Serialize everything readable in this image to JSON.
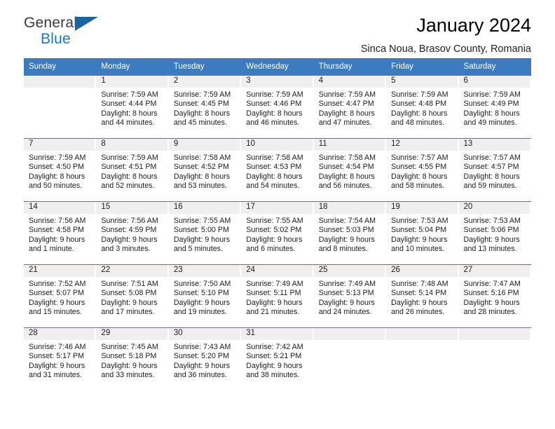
{
  "brand": {
    "name_top": "General",
    "name_bottom": "Blue",
    "accent": "#1a75c7",
    "triangle_color": "#18659f"
  },
  "header": {
    "title": "January 2024",
    "subtitle": "Sinca Noua, Brasov County, Romania"
  },
  "theme": {
    "header_row_bg": "#3a7cbf",
    "header_row_text": "#ffffff",
    "daynum_band_bg": "#efefef",
    "grid_line": "#3a7cbf"
  },
  "weekdays": [
    "Sunday",
    "Monday",
    "Tuesday",
    "Wednesday",
    "Thursday",
    "Friday",
    "Saturday"
  ],
  "labels": {
    "sunrise_prefix": "Sunrise:",
    "sunset_prefix": "Sunset:",
    "daylight_prefix": "Daylight:"
  },
  "weeks": [
    [
      {
        "day": "",
        "empty": true,
        "l1": "",
        "l2": "",
        "l3": "",
        "l4": ""
      },
      {
        "day": "1",
        "l1": "Sunrise: 7:59 AM",
        "l2": "Sunset: 4:44 PM",
        "l3": "Daylight: 8 hours",
        "l4": "and 44 minutes."
      },
      {
        "day": "2",
        "l1": "Sunrise: 7:59 AM",
        "l2": "Sunset: 4:45 PM",
        "l3": "Daylight: 8 hours",
        "l4": "and 45 minutes."
      },
      {
        "day": "3",
        "l1": "Sunrise: 7:59 AM",
        "l2": "Sunset: 4:46 PM",
        "l3": "Daylight: 8 hours",
        "l4": "and 46 minutes."
      },
      {
        "day": "4",
        "l1": "Sunrise: 7:59 AM",
        "l2": "Sunset: 4:47 PM",
        "l3": "Daylight: 8 hours",
        "l4": "and 47 minutes."
      },
      {
        "day": "5",
        "l1": "Sunrise: 7:59 AM",
        "l2": "Sunset: 4:48 PM",
        "l3": "Daylight: 8 hours",
        "l4": "and 48 minutes."
      },
      {
        "day": "6",
        "l1": "Sunrise: 7:59 AM",
        "l2": "Sunset: 4:49 PM",
        "l3": "Daylight: 8 hours",
        "l4": "and 49 minutes."
      }
    ],
    [
      {
        "day": "7",
        "l1": "Sunrise: 7:59 AM",
        "l2": "Sunset: 4:50 PM",
        "l3": "Daylight: 8 hours",
        "l4": "and 50 minutes."
      },
      {
        "day": "8",
        "l1": "Sunrise: 7:59 AM",
        "l2": "Sunset: 4:51 PM",
        "l3": "Daylight: 8 hours",
        "l4": "and 52 minutes."
      },
      {
        "day": "9",
        "l1": "Sunrise: 7:58 AM",
        "l2": "Sunset: 4:52 PM",
        "l3": "Daylight: 8 hours",
        "l4": "and 53 minutes."
      },
      {
        "day": "10",
        "l1": "Sunrise: 7:58 AM",
        "l2": "Sunset: 4:53 PM",
        "l3": "Daylight: 8 hours",
        "l4": "and 54 minutes."
      },
      {
        "day": "11",
        "l1": "Sunrise: 7:58 AM",
        "l2": "Sunset: 4:54 PM",
        "l3": "Daylight: 8 hours",
        "l4": "and 56 minutes."
      },
      {
        "day": "12",
        "l1": "Sunrise: 7:57 AM",
        "l2": "Sunset: 4:55 PM",
        "l3": "Daylight: 8 hours",
        "l4": "and 58 minutes."
      },
      {
        "day": "13",
        "l1": "Sunrise: 7:57 AM",
        "l2": "Sunset: 4:57 PM",
        "l3": "Daylight: 8 hours",
        "l4": "and 59 minutes."
      }
    ],
    [
      {
        "day": "14",
        "l1": "Sunrise: 7:56 AM",
        "l2": "Sunset: 4:58 PM",
        "l3": "Daylight: 9 hours",
        "l4": "and 1 minute."
      },
      {
        "day": "15",
        "l1": "Sunrise: 7:56 AM",
        "l2": "Sunset: 4:59 PM",
        "l3": "Daylight: 9 hours",
        "l4": "and 3 minutes."
      },
      {
        "day": "16",
        "l1": "Sunrise: 7:55 AM",
        "l2": "Sunset: 5:00 PM",
        "l3": "Daylight: 9 hours",
        "l4": "and 5 minutes."
      },
      {
        "day": "17",
        "l1": "Sunrise: 7:55 AM",
        "l2": "Sunset: 5:02 PM",
        "l3": "Daylight: 9 hours",
        "l4": "and 6 minutes."
      },
      {
        "day": "18",
        "l1": "Sunrise: 7:54 AM",
        "l2": "Sunset: 5:03 PM",
        "l3": "Daylight: 9 hours",
        "l4": "and 8 minutes."
      },
      {
        "day": "19",
        "l1": "Sunrise: 7:53 AM",
        "l2": "Sunset: 5:04 PM",
        "l3": "Daylight: 9 hours",
        "l4": "and 10 minutes."
      },
      {
        "day": "20",
        "l1": "Sunrise: 7:53 AM",
        "l2": "Sunset: 5:06 PM",
        "l3": "Daylight: 9 hours",
        "l4": "and 13 minutes."
      }
    ],
    [
      {
        "day": "21",
        "l1": "Sunrise: 7:52 AM",
        "l2": "Sunset: 5:07 PM",
        "l3": "Daylight: 9 hours",
        "l4": "and 15 minutes."
      },
      {
        "day": "22",
        "l1": "Sunrise: 7:51 AM",
        "l2": "Sunset: 5:08 PM",
        "l3": "Daylight: 9 hours",
        "l4": "and 17 minutes."
      },
      {
        "day": "23",
        "l1": "Sunrise: 7:50 AM",
        "l2": "Sunset: 5:10 PM",
        "l3": "Daylight: 9 hours",
        "l4": "and 19 minutes."
      },
      {
        "day": "24",
        "l1": "Sunrise: 7:49 AM",
        "l2": "Sunset: 5:11 PM",
        "l3": "Daylight: 9 hours",
        "l4": "and 21 minutes."
      },
      {
        "day": "25",
        "l1": "Sunrise: 7:49 AM",
        "l2": "Sunset: 5:13 PM",
        "l3": "Daylight: 9 hours",
        "l4": "and 24 minutes."
      },
      {
        "day": "26",
        "l1": "Sunrise: 7:48 AM",
        "l2": "Sunset: 5:14 PM",
        "l3": "Daylight: 9 hours",
        "l4": "and 26 minutes."
      },
      {
        "day": "27",
        "l1": "Sunrise: 7:47 AM",
        "l2": "Sunset: 5:16 PM",
        "l3": "Daylight: 9 hours",
        "l4": "and 28 minutes."
      }
    ],
    [
      {
        "day": "28",
        "l1": "Sunrise: 7:46 AM",
        "l2": "Sunset: 5:17 PM",
        "l3": "Daylight: 9 hours",
        "l4": "and 31 minutes."
      },
      {
        "day": "29",
        "l1": "Sunrise: 7:45 AM",
        "l2": "Sunset: 5:18 PM",
        "l3": "Daylight: 9 hours",
        "l4": "and 33 minutes."
      },
      {
        "day": "30",
        "l1": "Sunrise: 7:43 AM",
        "l2": "Sunset: 5:20 PM",
        "l3": "Daylight: 9 hours",
        "l4": "and 36 minutes."
      },
      {
        "day": "31",
        "l1": "Sunrise: 7:42 AM",
        "l2": "Sunset: 5:21 PM",
        "l3": "Daylight: 9 hours",
        "l4": "and 38 minutes."
      },
      {
        "day": "",
        "empty": true,
        "l1": "",
        "l2": "",
        "l3": "",
        "l4": ""
      },
      {
        "day": "",
        "empty": true,
        "l1": "",
        "l2": "",
        "l3": "",
        "l4": ""
      },
      {
        "day": "",
        "empty": true,
        "l1": "",
        "l2": "",
        "l3": "",
        "l4": ""
      }
    ]
  ]
}
